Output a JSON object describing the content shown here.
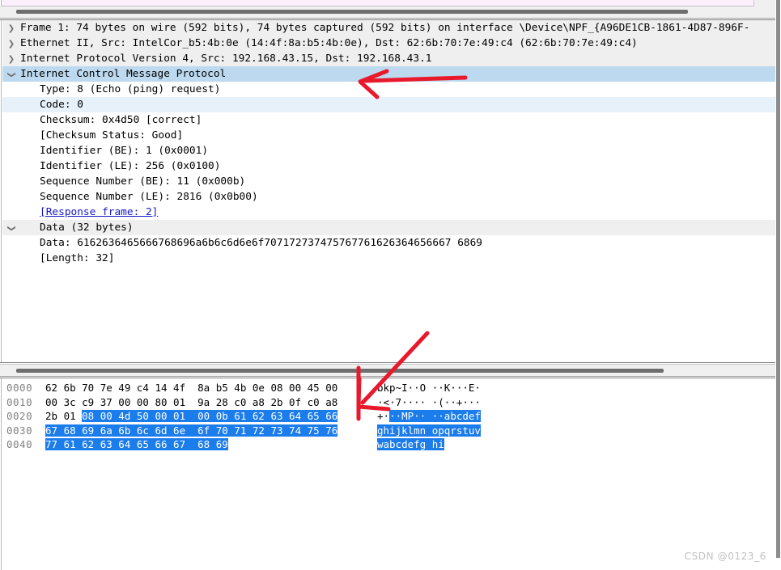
{
  "window": {
    "app": "Wireshark",
    "watermark": "CSDN @0123_6"
  },
  "detail_tree": {
    "rows": [
      {
        "twisty": "closed",
        "indent": 1,
        "text": "Frame 1: 74 bytes on wire (592 bits), 74 bytes captured (592 bits) on interface \\Device\\NPF_{A96DE1CB-1861-4D87-896F-",
        "style": "alt",
        "link": false
      },
      {
        "twisty": "closed",
        "indent": 1,
        "text": "Ethernet II, Src: IntelCor_b5:4b:0e (14:4f:8a:b5:4b:0e), Dst: 62:6b:70:7e:49:c4 (62:6b:70:7e:49:c4)",
        "style": "alt",
        "link": false
      },
      {
        "twisty": "closed",
        "indent": 1,
        "text": "Internet Protocol Version 4, Src: 192.168.43.15, Dst: 192.168.43.1",
        "style": "alt",
        "link": false
      },
      {
        "twisty": "open",
        "indent": 1,
        "text": "Internet Control Message Protocol",
        "style": "sel",
        "link": false
      },
      {
        "twisty": "blank",
        "indent": 2,
        "text": "Type: 8 (Echo (ping) request)",
        "style": "plain",
        "link": false
      },
      {
        "twisty": "blank",
        "indent": 2,
        "text": "Code: 0",
        "style": "sel-lt",
        "link": false
      },
      {
        "twisty": "blank",
        "indent": 2,
        "text": "Checksum: 0x4d50 [correct]",
        "style": "plain",
        "link": false
      },
      {
        "twisty": "blank",
        "indent": 2,
        "text": "[Checksum Status: Good]",
        "style": "plain",
        "link": false
      },
      {
        "twisty": "blank",
        "indent": 2,
        "text": "Identifier (BE): 1 (0x0001)",
        "style": "plain",
        "link": false
      },
      {
        "twisty": "blank",
        "indent": 2,
        "text": "Identifier (LE): 256 (0x0100)",
        "style": "plain",
        "link": false
      },
      {
        "twisty": "blank",
        "indent": 2,
        "text": "Sequence Number (BE): 11 (0x000b)",
        "style": "plain",
        "link": false
      },
      {
        "twisty": "blank",
        "indent": 2,
        "text": "Sequence Number (LE): 2816 (0x0b00)",
        "style": "plain",
        "link": false
      },
      {
        "twisty": "blank",
        "indent": 2,
        "text": "[Response frame: 2]",
        "style": "plain",
        "link": true
      },
      {
        "twisty": "open",
        "indent": 2,
        "text": "Data (32 bytes)",
        "style": "alt",
        "link": false
      },
      {
        "twisty": "blank",
        "indent": 3,
        "text": "Data: 6162636465666768696a6b6c6d6e6f707172737475767761626364656667 6869",
        "style": "plain",
        "link": false
      },
      {
        "twisty": "blank",
        "indent": 3,
        "text": "[Length: 32]",
        "style": "plain",
        "link": false
      }
    ]
  },
  "hex_dump": {
    "rows": [
      {
        "offset": "0000",
        "hex_groups": [
          {
            "text": "62 6b 70 7e 49 c4 14 4f",
            "hl": false
          },
          {
            "text": "  ",
            "hl": false
          },
          {
            "text": "8a b5 4b 0e 08 00 45 00",
            "hl": false
          }
        ],
        "ascii_groups": [
          {
            "text": "bkp~I··O",
            "hl": false
          },
          {
            "text": " ",
            "hl": false
          },
          {
            "text": "··K···E·",
            "hl": false
          }
        ]
      },
      {
        "offset": "0010",
        "hex_groups": [
          {
            "text": "00 3c c9 37 00 00 80 01",
            "hl": false
          },
          {
            "text": "  ",
            "hl": false
          },
          {
            "text": "9a 28 c0 a8 2b 0f c0 a8",
            "hl": false
          }
        ],
        "ascii_groups": [
          {
            "text": "·<·7····",
            "hl": false
          },
          {
            "text": " ",
            "hl": false
          },
          {
            "text": "·(··+···",
            "hl": false
          }
        ]
      },
      {
        "offset": "0020",
        "hex_groups": [
          {
            "text": "2b 01 ",
            "hl": false
          },
          {
            "text": "08 00 4d 50 00 01",
            "hl": true
          },
          {
            "text": "  ",
            "hl": true
          },
          {
            "text": "00 0b 61 62 63 64 65 66",
            "hl": true
          }
        ],
        "ascii_groups": [
          {
            "text": "+·",
            "hl": false
          },
          {
            "text": "··MP··",
            "hl": true
          },
          {
            "text": " ",
            "hl": true
          },
          {
            "text": "··abcdef",
            "hl": true
          }
        ]
      },
      {
        "offset": "0030",
        "hex_groups": [
          {
            "text": "67 68 69 6a 6b 6c 6d 6e",
            "hl": true
          },
          {
            "text": "  ",
            "hl": true
          },
          {
            "text": "6f 70 71 72 73 74 75 76",
            "hl": true
          }
        ],
        "ascii_groups": [
          {
            "text": "ghijklmn",
            "hl": true
          },
          {
            "text": " ",
            "hl": true
          },
          {
            "text": "opqrstuv",
            "hl": true
          }
        ]
      },
      {
        "offset": "0040",
        "hex_groups": [
          {
            "text": "77 61 62 63 64 65 66 67",
            "hl": true
          },
          {
            "text": "  ",
            "hl": true
          },
          {
            "text": "68 69",
            "hl": true
          }
        ],
        "ascii_groups": [
          {
            "text": "wabcdefg",
            "hl": true
          },
          {
            "text": " ",
            "hl": true
          },
          {
            "text": "hi",
            "hl": true
          }
        ]
      }
    ]
  },
  "annotations": {
    "arrow_icmp": "red-arrow-pointing-to-icmp-row",
    "arrow_hex": "red-arrow-pointing-to-hex-offset-0020"
  }
}
